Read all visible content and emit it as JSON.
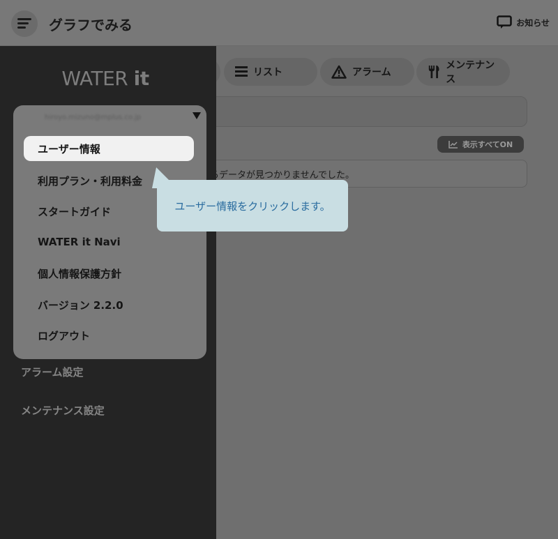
{
  "header": {
    "title": "グラフでみる",
    "notice_label": "お知らせ"
  },
  "tabs": [
    {
      "label": "リスト",
      "icon": "list-icon"
    },
    {
      "label": "アラーム",
      "icon": "warning-icon"
    },
    {
      "label": "メンテナンス",
      "icon": "tools-icon"
    }
  ],
  "main": {
    "show_all_label": "表示すべてON",
    "no_data_text": "るデータが見つかりませんでした。"
  },
  "sidebar": {
    "brand": "WATER",
    "brand_suffix": "it",
    "email": "hiroyo.mizuno@mplus.co.jp",
    "menu_items": [
      "ユーザー情報",
      "利用プラン・利用料金",
      "スタートガイド",
      "WATER it Navi",
      "個人情報保護方針",
      "バージョン 2.2.0",
      "ログアウト"
    ],
    "settings_items": [
      "アラーム設定",
      "メンテナンス設定"
    ]
  },
  "tooltip": {
    "text": "ユーザー情報をクリックします。"
  },
  "colors": {
    "sidebar_bg": "#242424",
    "tooltip_bg": "#c9dee3",
    "tooltip_text": "#2a6c9f"
  }
}
